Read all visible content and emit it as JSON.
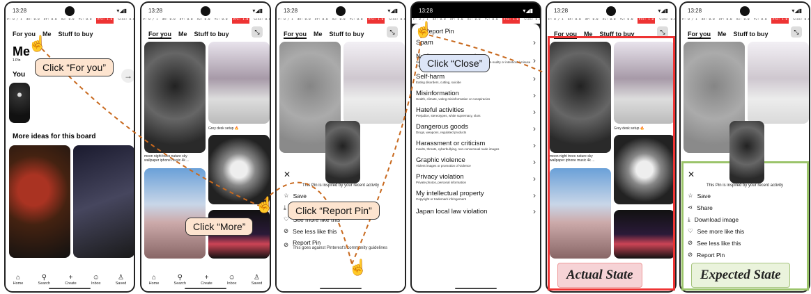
{
  "status": {
    "time": "13:28"
  },
  "debug": {
    "p": "P: 0 / 1",
    "dx": "dX: 0.0",
    "dy": "dY: 0.0",
    "xv": "Xv: 0.0",
    "yv": "Yv: 0.0",
    "prs": "Prs: 1.0",
    "size": "Size: 0.0"
  },
  "tabs": {
    "for_you": "For you",
    "me": "Me",
    "stuff": "Stuff to buy"
  },
  "panel1": {
    "title": "Me",
    "subtitle": "1 Pin",
    "section_partial": "You",
    "more_ideas": "More ideas for this board"
  },
  "nav": {
    "home": "Home",
    "search": "Search",
    "create": "Create",
    "inbox": "Inbox",
    "saved": "Saved"
  },
  "captions": {
    "grey_desk": "Grey desk setup 🔥",
    "moon_night": "moon night trees nature sky wallpaper iphone music 4k ..."
  },
  "sheet": {
    "inspired": "This Pin is inspired by your recent activity",
    "save": "Save",
    "share": "Share",
    "download": "Download image",
    "see_more": "See more like this",
    "see_less": "See less like this",
    "report": "Report Pin",
    "report_desc": "This goes against Pinterest's community guidelines"
  },
  "report": {
    "header": "Report Pin",
    "items": [
      {
        "t": "Spam",
        "d": ""
      },
      {
        "t": "Nudity or pornography",
        "d": "Sexually explicit content involving adults or nudity, non-nudity or intentional misuse involving minors"
      },
      {
        "t": "Self-harm",
        "d": "Eating disorders, cutting, suicide"
      },
      {
        "t": "Misinformation",
        "d": "Health, climate, voting misinformation or conspiracies"
      },
      {
        "t": "Hateful activities",
        "d": "Prejudice, stereotypes, white supremacy, slurs"
      },
      {
        "t": "Dangerous goods",
        "d": "Drugs, weapons, regulated products"
      },
      {
        "t": "Harassment or criticism",
        "d": "Insults, threats, cyberbullying, non-consensual nude images"
      },
      {
        "t": "Graphic violence",
        "d": "Violent images or promotion of violence"
      },
      {
        "t": "Privacy violation",
        "d": "Private photos, personal information"
      },
      {
        "t": "My intellectual property",
        "d": "Copyright or trademark infringement"
      },
      {
        "t": "Japan local law violation",
        "d": ""
      }
    ]
  },
  "callouts": {
    "for_you": "Click “For you”",
    "more": "Click “More”",
    "report": "Click “Report Pin”",
    "close": "Click “Close”"
  },
  "labels": {
    "actual": "Actual State",
    "expected": "Expected State"
  }
}
